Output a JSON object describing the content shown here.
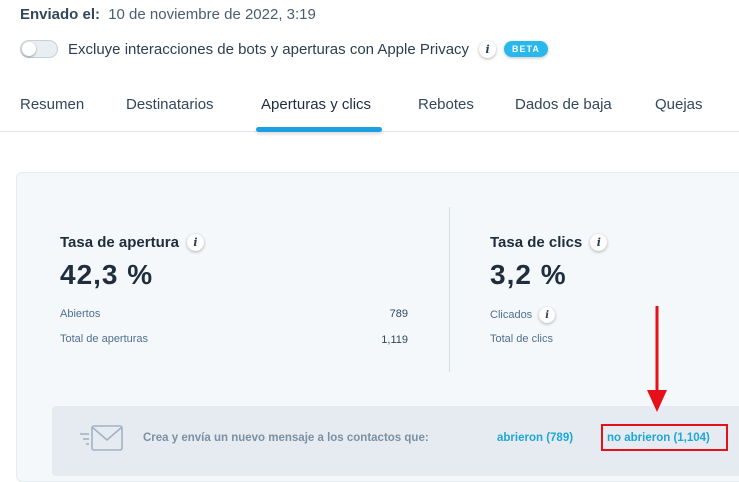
{
  "header": {
    "sent_label": "Enviado el:",
    "sent_value": "10 de noviembre de 2022, 3:19"
  },
  "filter": {
    "toggle_on": false,
    "label": "Excluye interacciones de bots y aperturas con Apple Privacy",
    "info_glyph": "i",
    "badge": "BETA"
  },
  "tabs": [
    {
      "label": "Resumen",
      "active": false
    },
    {
      "label": "Destinatarios",
      "active": false
    },
    {
      "label": "Aperturas y clics",
      "active": true
    },
    {
      "label": "Rebotes",
      "active": false
    },
    {
      "label": "Dados de baja",
      "active": false
    },
    {
      "label": "Quejas",
      "active": false
    }
  ],
  "open_rate": {
    "title": "Tasa de apertura",
    "value": "42,3 %",
    "rows": [
      {
        "label": "Abiertos",
        "value": "789"
      },
      {
        "label": "Total de aperturas",
        "value": "1,119"
      }
    ]
  },
  "click_rate": {
    "title": "Tasa de clics",
    "value": "3,2 %",
    "rows": [
      {
        "label": "Clicados",
        "value": ""
      },
      {
        "label": "Total de clics",
        "value": ""
      }
    ]
  },
  "cta": {
    "text": "Crea y envía un nuevo mensaje a los contactos que:",
    "opened_link": "abrieron (789)",
    "not_opened_link": "no abrieron (1,104)"
  },
  "colors": {
    "accent": "#1c9fe0",
    "link": "#1ea6d8",
    "annotation": "#e6101b",
    "beta_badge": "#28b8ec"
  }
}
